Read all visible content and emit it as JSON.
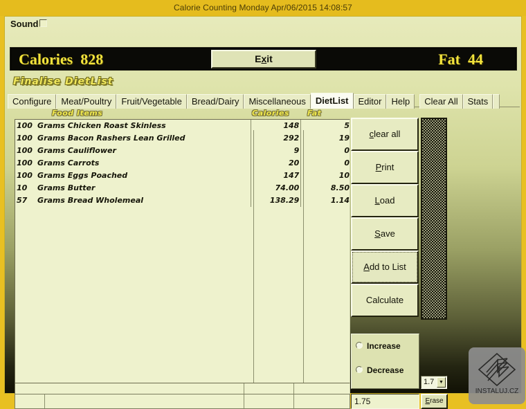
{
  "window": {
    "title": "Calorie Counting Monday Apr/06/2015 14:08:57"
  },
  "toolbar": {
    "sound_label": "Sound",
    "exit_label": "Exit",
    "exit_accel": "x",
    "exit_pre": "E",
    "exit_post": "it"
  },
  "totals": {
    "calories_text": "Calories  828",
    "fat_text": "Fat  44",
    "calories_label": "Calories",
    "calories_value": "828",
    "fat_label": "Fat",
    "fat_value": "44"
  },
  "heading": {
    "text": "Finalise DietList"
  },
  "tabs": [
    {
      "label": "Configure",
      "active": false
    },
    {
      "label": "Meat/Poultry",
      "active": false
    },
    {
      "label": "Fruit/Vegetable",
      "active": false
    },
    {
      "label": "Bread/Dairy",
      "active": false
    },
    {
      "label": "Miscellaneous",
      "active": false
    },
    {
      "label": "DietList",
      "active": true
    },
    {
      "label": "Editor",
      "active": false
    },
    {
      "label": "Help",
      "active": false
    },
    {
      "label": "Clear All",
      "active": false
    },
    {
      "label": "Stats",
      "active": false
    }
  ],
  "grid": {
    "headers": {
      "food": "Food Items",
      "calories": "Calories",
      "fat": "Fat"
    },
    "rows": [
      {
        "qty": "100",
        "name": "Grams Chicken Roast Skinless",
        "calories": "148",
        "fat": "5"
      },
      {
        "qty": "100",
        "name": "Grams Bacon Rashers Lean Grilled",
        "calories": "292",
        "fat": "19"
      },
      {
        "qty": "100",
        "name": "Grams Cauliflower",
        "calories": "9",
        "fat": "0"
      },
      {
        "qty": "100",
        "name": "Grams Carrots",
        "calories": "20",
        "fat": "0"
      },
      {
        "qty": "100",
        "name": "Grams Eggs Poached",
        "calories": "147",
        "fat": "10"
      },
      {
        "qty": "10",
        "name": "Grams Butter",
        "calories": "74.00",
        "fat": "8.50"
      },
      {
        "qty": "57",
        "name": "Grams Bread Wholemeal",
        "calories": "138.29",
        "fat": "1.14"
      }
    ]
  },
  "buttons": [
    {
      "label": "clear all",
      "accel_pre": "",
      "accel": "c",
      "accel_post": "lear all",
      "focused": false
    },
    {
      "label": "Print",
      "accel_pre": "",
      "accel": "P",
      "accel_post": "rint",
      "focused": false
    },
    {
      "label": "Load",
      "accel_pre": "",
      "accel": "L",
      "accel_post": "oad",
      "focused": false
    },
    {
      "label": "Save",
      "accel_pre": "",
      "accel": "S",
      "accel_post": "ave",
      "focused": false
    },
    {
      "label": "Add to List",
      "accel_pre": "",
      "accel": "A",
      "accel_post": "dd to List",
      "focused": true
    },
    {
      "label": "Calculate",
      "accel_pre": "",
      "accel": "",
      "accel_post": "Calculate",
      "focused": false
    }
  ],
  "adjust": {
    "increase_label": "Increase",
    "decrease_label": "Decrease",
    "increase_selected": false,
    "decrease_selected": false
  },
  "combo": {
    "value": "1.7",
    "arrow": "▼"
  },
  "bottom": {
    "value_field": "1.75",
    "erase_label": "Erase",
    "erase_pre": "",
    "erase_accel": "E",
    "erase_post": "rase"
  },
  "watermark": {
    "text": "INSTALUJ.CZ"
  },
  "colors": {
    "title_bar": "#e5bc1e",
    "window_frame": "#e8c022",
    "panel_light": "#e9ecc6",
    "grid_bg": "#eef2cd",
    "totals_bg": "#0a0a06",
    "totals_fg": "#f2e33c",
    "heading_fg": "#f0e75c"
  }
}
